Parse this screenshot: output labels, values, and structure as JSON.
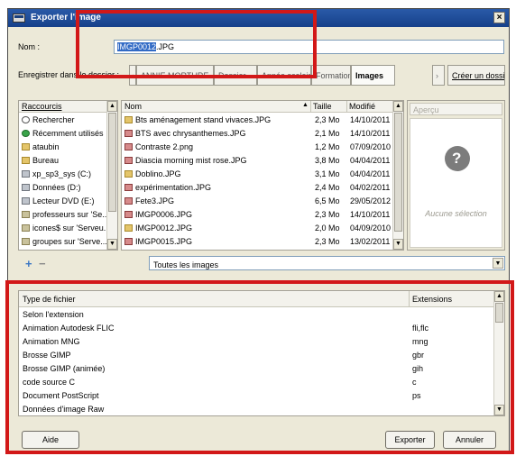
{
  "window": {
    "title": "Exporter l'image",
    "close_label": "×"
  },
  "name_field": {
    "label": "Nom :",
    "value_selected": "IMGP0012",
    "value_ext": ".JPG"
  },
  "save_in": {
    "label": "Enregistrer dans le dossier :",
    "path_buttons": [
      "ANNIE MORTURE",
      "Dossier",
      "Année scolaire",
      "Formation",
      "Images"
    ],
    "nav_icon": "chevron-right-icon",
    "create_folder_label": "Créer un dossier"
  },
  "shortcuts": {
    "header": "Raccourcis",
    "items": [
      {
        "icon": "search-icon",
        "label": "Rechercher"
      },
      {
        "icon": "recent-icon",
        "label": "Récemment utilisés"
      },
      {
        "icon": "folder-icon",
        "label": "ataubin"
      },
      {
        "icon": "folder-icon",
        "label": "Bureau"
      },
      {
        "icon": "drive-icon",
        "label": "xp_sp3_sys (C:)"
      },
      {
        "icon": "drive-icon",
        "label": "Données (D:)"
      },
      {
        "icon": "drive-icon",
        "label": "Lecteur DVD (E:)"
      },
      {
        "icon": "network-icon",
        "label": "professeurs sur 'Se..."
      },
      {
        "icon": "network-icon",
        "label": "icones$ sur 'Serveu..."
      },
      {
        "icon": "network-icon",
        "label": "groupes sur 'Serve..."
      }
    ],
    "add_icon": "add-icon",
    "remove_icon": "remove-icon"
  },
  "files": {
    "columns": {
      "name": "Nom",
      "size": "Taille",
      "modified": "Modifié"
    },
    "sort_icon": "sort-up-icon",
    "rows": [
      {
        "icon": "folder-icon",
        "name": "Bts aménagement stand vivaces.JPG",
        "size": "2,3 Mo",
        "modified": "14/10/2011"
      },
      {
        "icon": "image-icon",
        "name": "BTS avec chrysanthemes.JPG",
        "size": "2,1 Mo",
        "modified": "14/10/2011"
      },
      {
        "icon": "image-icon",
        "name": "Contraste 2.png",
        "size": "1,2 Mo",
        "modified": "07/09/2010"
      },
      {
        "icon": "image-icon",
        "name": "Diascia morning mist rose.JPG",
        "size": "3,8 Mo",
        "modified": "04/04/2011"
      },
      {
        "icon": "folder-icon",
        "name": "Doblino.JPG",
        "size": "3,1 Mo",
        "modified": "04/04/2011"
      },
      {
        "icon": "image-icon",
        "name": "expérimentation.JPG",
        "size": "2,4 Mo",
        "modified": "04/02/2011"
      },
      {
        "icon": "image-icon",
        "name": "Fete3.JPG",
        "size": "6,5 Mo",
        "modified": "29/05/2012"
      },
      {
        "icon": "image-icon",
        "name": "IMGP0006.JPG",
        "size": "2,3 Mo",
        "modified": "14/10/2011"
      },
      {
        "icon": "folder-icon",
        "name": "IMGP0012.JPG",
        "size": "2,0 Mo",
        "modified": "04/09/2010"
      },
      {
        "icon": "image-icon",
        "name": "IMGP0015.JPG",
        "size": "2,3 Mo",
        "modified": "13/02/2011"
      }
    ]
  },
  "preview": {
    "header": "Aperçu",
    "empty_text": "Aucune sélection",
    "mascot_icon": "gimp-mascot-icon"
  },
  "filter": {
    "value": "Toutes les images"
  },
  "filetypes": {
    "columns": {
      "type": "Type de fichier",
      "ext": "Extensions"
    },
    "rows": [
      {
        "type": "Selon l'extension",
        "ext": ""
      },
      {
        "type": "Animation Autodesk FLIC",
        "ext": "fli,flc"
      },
      {
        "type": "Animation MNG",
        "ext": "mng"
      },
      {
        "type": "Brosse GIMP",
        "ext": "gbr"
      },
      {
        "type": "Brosse GIMP (animée)",
        "ext": "gih"
      },
      {
        "type": "code source C",
        "ext": "c"
      },
      {
        "type": "Document PostScript",
        "ext": "ps"
      },
      {
        "type": "Données d'image Raw",
        "ext": ""
      }
    ]
  },
  "buttons": {
    "help": "Aide",
    "export": "Exporter",
    "cancel": "Annuler"
  },
  "colors": {
    "title_bar": "#1f4d9a",
    "highlight": "#d21818",
    "selection": "#316ac5"
  }
}
